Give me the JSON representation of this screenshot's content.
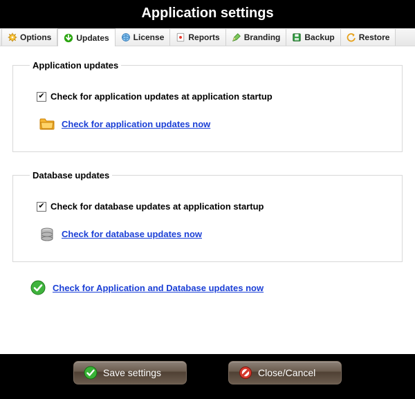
{
  "title": "Application settings",
  "tabs": {
    "options": "Options",
    "updates": "Updates",
    "license": "License",
    "reports": "Reports",
    "branding": "Branding",
    "backup": "Backup",
    "restore": "Restore"
  },
  "active_tab": "updates",
  "groups": {
    "app": {
      "legend": "Application updates",
      "checkbox_label": "Check for application updates at application startup",
      "checkbox_checked": true,
      "link_text": "Check for application updates now"
    },
    "db": {
      "legend": "Database updates",
      "checkbox_label": "Check for database updates at application startup",
      "checkbox_checked": true,
      "link_text": "Check for database updates now"
    }
  },
  "combined_link": "Check for Application and Database updates now",
  "buttons": {
    "save": "Save settings",
    "cancel": "Close/Cancel"
  }
}
